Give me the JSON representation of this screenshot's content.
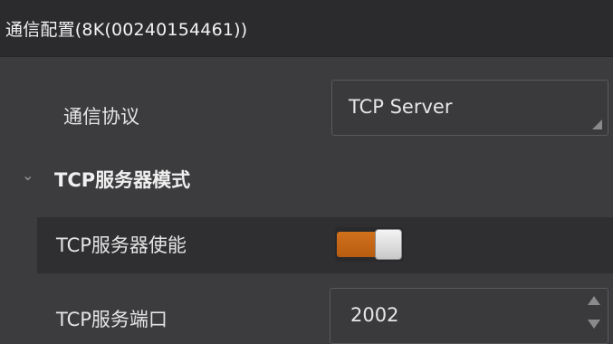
{
  "header": {
    "title": "通信配置(8K(00240154461))"
  },
  "protocol": {
    "label": "通信协议",
    "value": "TCP Server"
  },
  "section": {
    "chevron": "⌄",
    "title": "TCP服务器模式"
  },
  "server_enable": {
    "label": "TCP服务器使能",
    "enabled": true,
    "accent_color": "#c9681a"
  },
  "server_port": {
    "label": "TCP服务端口",
    "value": "2002"
  }
}
